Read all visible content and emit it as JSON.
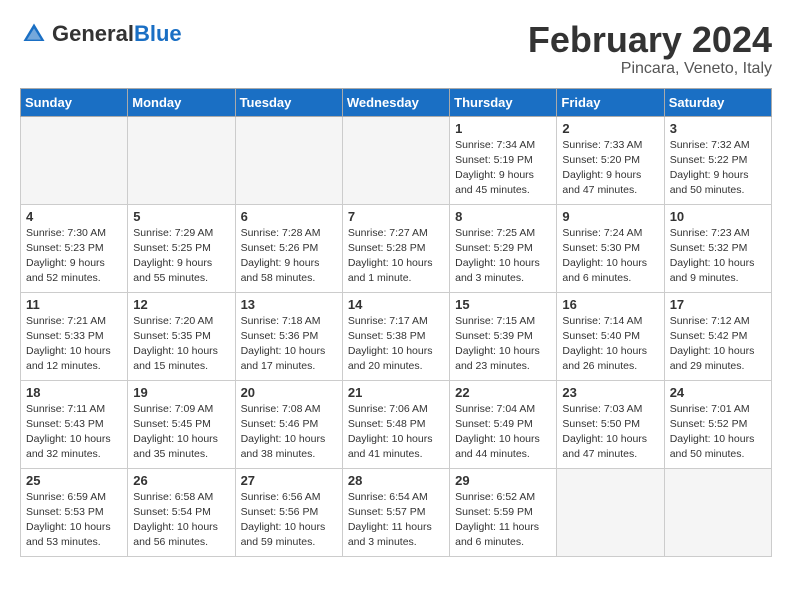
{
  "header": {
    "logo_general": "General",
    "logo_blue": "Blue",
    "month_title": "February 2024",
    "location": "Pincara, Veneto, Italy"
  },
  "days_of_week": [
    "Sunday",
    "Monday",
    "Tuesday",
    "Wednesday",
    "Thursday",
    "Friday",
    "Saturday"
  ],
  "weeks": [
    [
      {
        "day": "",
        "info": ""
      },
      {
        "day": "",
        "info": ""
      },
      {
        "day": "",
        "info": ""
      },
      {
        "day": "",
        "info": ""
      },
      {
        "day": "1",
        "info": "Sunrise: 7:34 AM\nSunset: 5:19 PM\nDaylight: 9 hours\nand 45 minutes."
      },
      {
        "day": "2",
        "info": "Sunrise: 7:33 AM\nSunset: 5:20 PM\nDaylight: 9 hours\nand 47 minutes."
      },
      {
        "day": "3",
        "info": "Sunrise: 7:32 AM\nSunset: 5:22 PM\nDaylight: 9 hours\nand 50 minutes."
      }
    ],
    [
      {
        "day": "4",
        "info": "Sunrise: 7:30 AM\nSunset: 5:23 PM\nDaylight: 9 hours\nand 52 minutes."
      },
      {
        "day": "5",
        "info": "Sunrise: 7:29 AM\nSunset: 5:25 PM\nDaylight: 9 hours\nand 55 minutes."
      },
      {
        "day": "6",
        "info": "Sunrise: 7:28 AM\nSunset: 5:26 PM\nDaylight: 9 hours\nand 58 minutes."
      },
      {
        "day": "7",
        "info": "Sunrise: 7:27 AM\nSunset: 5:28 PM\nDaylight: 10 hours\nand 1 minute."
      },
      {
        "day": "8",
        "info": "Sunrise: 7:25 AM\nSunset: 5:29 PM\nDaylight: 10 hours\nand 3 minutes."
      },
      {
        "day": "9",
        "info": "Sunrise: 7:24 AM\nSunset: 5:30 PM\nDaylight: 10 hours\nand 6 minutes."
      },
      {
        "day": "10",
        "info": "Sunrise: 7:23 AM\nSunset: 5:32 PM\nDaylight: 10 hours\nand 9 minutes."
      }
    ],
    [
      {
        "day": "11",
        "info": "Sunrise: 7:21 AM\nSunset: 5:33 PM\nDaylight: 10 hours\nand 12 minutes."
      },
      {
        "day": "12",
        "info": "Sunrise: 7:20 AM\nSunset: 5:35 PM\nDaylight: 10 hours\nand 15 minutes."
      },
      {
        "day": "13",
        "info": "Sunrise: 7:18 AM\nSunset: 5:36 PM\nDaylight: 10 hours\nand 17 minutes."
      },
      {
        "day": "14",
        "info": "Sunrise: 7:17 AM\nSunset: 5:38 PM\nDaylight: 10 hours\nand 20 minutes."
      },
      {
        "day": "15",
        "info": "Sunrise: 7:15 AM\nSunset: 5:39 PM\nDaylight: 10 hours\nand 23 minutes."
      },
      {
        "day": "16",
        "info": "Sunrise: 7:14 AM\nSunset: 5:40 PM\nDaylight: 10 hours\nand 26 minutes."
      },
      {
        "day": "17",
        "info": "Sunrise: 7:12 AM\nSunset: 5:42 PM\nDaylight: 10 hours\nand 29 minutes."
      }
    ],
    [
      {
        "day": "18",
        "info": "Sunrise: 7:11 AM\nSunset: 5:43 PM\nDaylight: 10 hours\nand 32 minutes."
      },
      {
        "day": "19",
        "info": "Sunrise: 7:09 AM\nSunset: 5:45 PM\nDaylight: 10 hours\nand 35 minutes."
      },
      {
        "day": "20",
        "info": "Sunrise: 7:08 AM\nSunset: 5:46 PM\nDaylight: 10 hours\nand 38 minutes."
      },
      {
        "day": "21",
        "info": "Sunrise: 7:06 AM\nSunset: 5:48 PM\nDaylight: 10 hours\nand 41 minutes."
      },
      {
        "day": "22",
        "info": "Sunrise: 7:04 AM\nSunset: 5:49 PM\nDaylight: 10 hours\nand 44 minutes."
      },
      {
        "day": "23",
        "info": "Sunrise: 7:03 AM\nSunset: 5:50 PM\nDaylight: 10 hours\nand 47 minutes."
      },
      {
        "day": "24",
        "info": "Sunrise: 7:01 AM\nSunset: 5:52 PM\nDaylight: 10 hours\nand 50 minutes."
      }
    ],
    [
      {
        "day": "25",
        "info": "Sunrise: 6:59 AM\nSunset: 5:53 PM\nDaylight: 10 hours\nand 53 minutes."
      },
      {
        "day": "26",
        "info": "Sunrise: 6:58 AM\nSunset: 5:54 PM\nDaylight: 10 hours\nand 56 minutes."
      },
      {
        "day": "27",
        "info": "Sunrise: 6:56 AM\nSunset: 5:56 PM\nDaylight: 10 hours\nand 59 minutes."
      },
      {
        "day": "28",
        "info": "Sunrise: 6:54 AM\nSunset: 5:57 PM\nDaylight: 11 hours\nand 3 minutes."
      },
      {
        "day": "29",
        "info": "Sunrise: 6:52 AM\nSunset: 5:59 PM\nDaylight: 11 hours\nand 6 minutes."
      },
      {
        "day": "",
        "info": ""
      },
      {
        "day": "",
        "info": ""
      }
    ]
  ]
}
